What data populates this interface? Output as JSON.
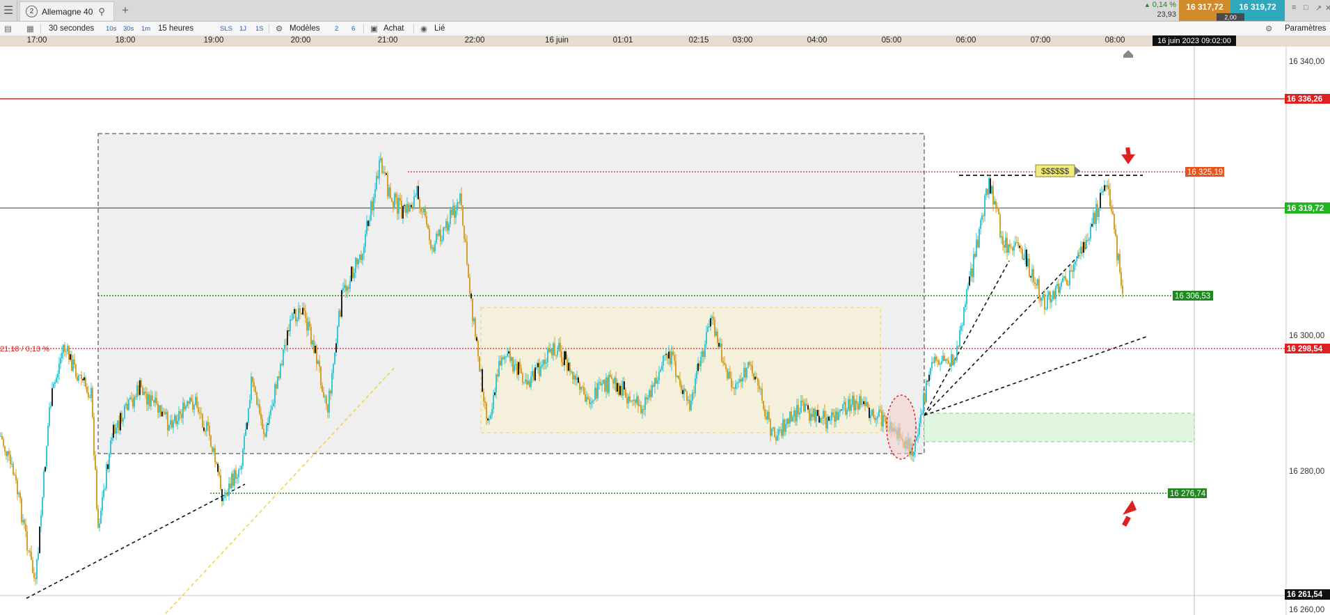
{
  "app": {
    "menu_icon": "hamburger-icon",
    "tab": {
      "number": "2",
      "title": "Allemagne 40",
      "search_icon": "search-icon"
    },
    "add_tab_icon": "plus-icon",
    "change_pct": "0,14 %",
    "change_pts": "23,93",
    "sell_price": "16 317,72",
    "buy_price": "16 319,72",
    "spread": "2,00",
    "window_icons": [
      "collapse-icon",
      "restore-icon",
      "popout-icon",
      "close-icon"
    ]
  },
  "toolbar": {
    "interval_value": "30 secondes",
    "quick_intervals": [
      "10s",
      "30s",
      "1m"
    ],
    "period_value": "15 heures",
    "period_buttons": [
      "SLS",
      "1J",
      "1S"
    ],
    "templates_label": "Modèles",
    "layout_buttons": [
      "2",
      "6"
    ],
    "order_label": "Achat",
    "linked_label": "Lié",
    "settings_label": "Paramètres"
  },
  "time_axis": {
    "ticks": [
      "17:00",
      "18:00",
      "19:00",
      "20:00",
      "21:00",
      "22:00",
      "16 juin",
      "01:01",
      "02:15",
      "03:00",
      "04:00",
      "05:00",
      "06:00",
      "07:00",
      "08:00"
    ],
    "cursor_label": "16 juin 2023 09:02:00"
  },
  "price_axis": {
    "ticks": [
      "16 340,00",
      "16 300,00",
      "16 280,00",
      "16 260,00"
    ],
    "level_labels": {
      "red_line": "16 336,26",
      "resistance": "16 325,19",
      "current": "16 319,72",
      "green_mid": "16 306,53",
      "prev_close": "16 298,54",
      "support": "16 276,74",
      "cursor": "16 261,54"
    },
    "prev_close_note": "21,18 / 0,13 %"
  },
  "annotations": {
    "flag_label": "$$$$$$",
    "arrow_down_icon": "red-arrow-down-icon",
    "arrow_up_icon": "red-arrow-up-icon"
  },
  "colors": {
    "sell": "#d18b2a",
    "buy": "#2fa8be",
    "candles_up": "#37c7d6",
    "candles_down": "#d4a12a",
    "red_level": "#e02020",
    "green_level": "#1e8a1e",
    "current_label": "#22b522"
  }
}
